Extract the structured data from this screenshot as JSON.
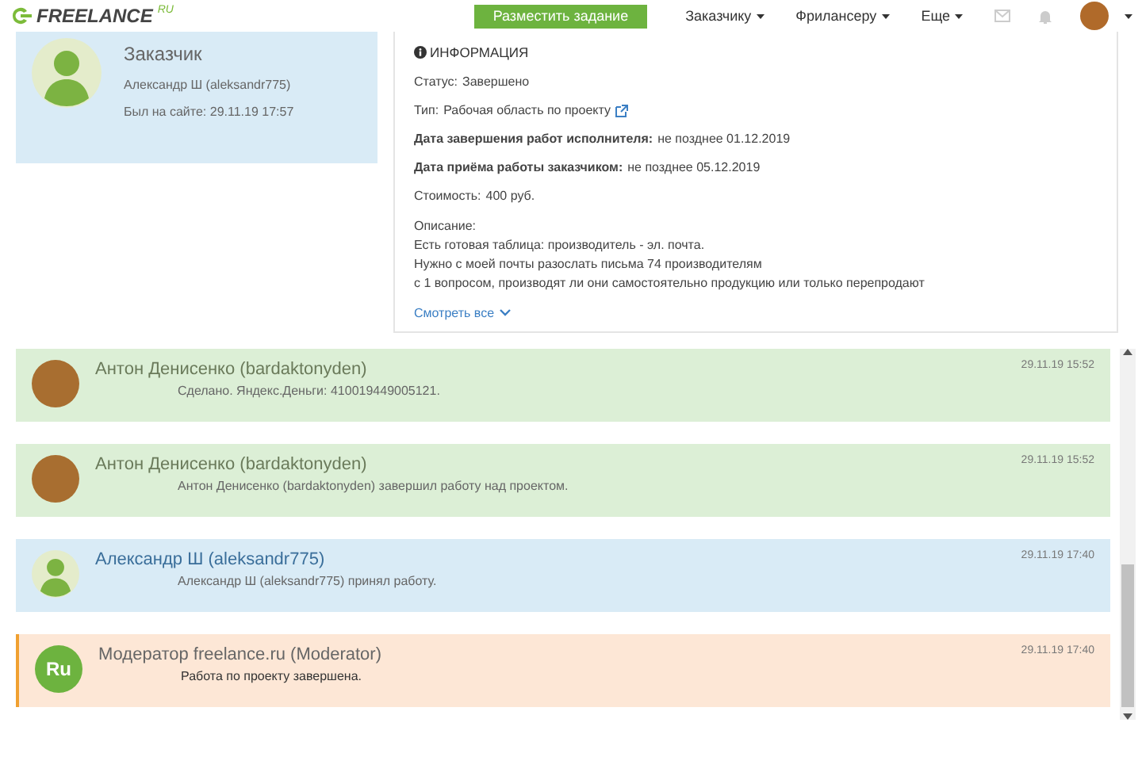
{
  "header": {
    "logo": "FREELANCE",
    "logo_suffix": "RU",
    "post_button": "Разместить задание",
    "menu": [
      "Заказчику",
      "Фрилансеру",
      "Еще"
    ]
  },
  "customer": {
    "role": "Заказчик",
    "name": "Александр Ш (aleksandr775)",
    "last_seen": "Был на сайте: 29.11.19 17:57"
  },
  "info": {
    "title": "ИНФОРМАЦИЯ",
    "fields": [
      {
        "label": "Статус:",
        "value": "Завершено",
        "strong": false,
        "link": false
      },
      {
        "label": "Тип:",
        "value": "Рабочая область по проекту",
        "strong": false,
        "link": true
      },
      {
        "label": "Дата завершения работ исполнителя:",
        "value": "не позднее 01.12.2019",
        "strong": true,
        "link": false
      },
      {
        "label": "Дата приёма работы заказчиком:",
        "value": "не позднее 05.12.2019",
        "strong": true,
        "link": false
      },
      {
        "label": "Стоимость:",
        "value": "400 руб.",
        "strong": false,
        "link": false
      }
    ],
    "description_label": "Описание:",
    "description": [
      "Есть готовая таблица: производитель - эл. почта.",
      "Нужно с моей почты разослать письма 74 производителям",
      "с 1 вопросом, производят ли они самостоятельно продукцию или только перепродают"
    ],
    "more": "Смотреть все"
  },
  "messages": [
    {
      "kind": "freelancer",
      "author": "Антон Денисенко (bardaktonyden)",
      "time": "29.11.19 15:52",
      "text": "Сделано. Яндекс.Деньги: 410019449005121."
    },
    {
      "kind": "freelancer",
      "author": "Антон Денисенко (bardaktonyden)",
      "time": "29.11.19 15:52",
      "text": "Антон Денисенко (bardaktonyden) завершил работу над проектом."
    },
    {
      "kind": "customer",
      "author": "Александр Ш (aleksandr775)",
      "time": "29.11.19 17:40",
      "text": "Александр Ш (aleksandr775) принял работу."
    },
    {
      "kind": "moderator",
      "author": "Модератор freelance.ru (Moderator)",
      "time": "29.11.19 17:40",
      "text": "Работа по проекту завершена.",
      "badge": "Ru"
    }
  ]
}
